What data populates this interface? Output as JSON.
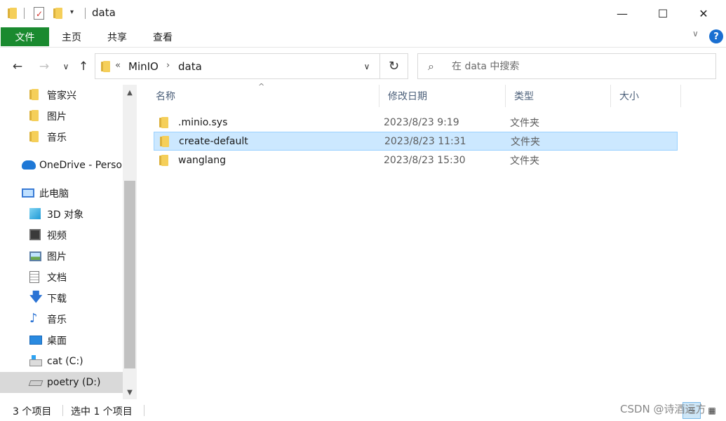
{
  "window": {
    "title": "data",
    "controls": {
      "minimize": "—",
      "maximize": "☐",
      "close": "✕"
    },
    "quick_access_dropdown": "▾"
  },
  "ribbon": {
    "file_tab": "文件",
    "tabs": [
      "主页",
      "共享",
      "查看"
    ],
    "expand_chevron": "∨",
    "help": "?"
  },
  "nav_buttons": {
    "back": "←",
    "forward": "→",
    "recent": "∨",
    "up": "↑"
  },
  "address": {
    "overflow": "«",
    "breadcrumbs": [
      "MinIO",
      "data"
    ],
    "separator": "›",
    "dropdown": "∨",
    "refresh": "↻"
  },
  "search": {
    "placeholder": "在 data 中搜索",
    "value": "",
    "icon": "search-icon"
  },
  "nav_pane": {
    "items": [
      {
        "label": "管家兴",
        "icon": "folder-icon"
      },
      {
        "label": "图片",
        "icon": "folder-icon"
      },
      {
        "label": "音乐",
        "icon": "folder-icon"
      },
      {
        "label": "OneDrive - Perso",
        "icon": "onedrive-icon"
      },
      {
        "label": "此电脑",
        "icon": "this-pc-icon"
      },
      {
        "label": "3D 对象",
        "icon": "3d-objects-icon"
      },
      {
        "label": "视频",
        "icon": "videos-icon"
      },
      {
        "label": "图片",
        "icon": "pictures-icon"
      },
      {
        "label": "文档",
        "icon": "documents-icon"
      },
      {
        "label": "下载",
        "icon": "downloads-icon"
      },
      {
        "label": "音乐",
        "icon": "music-icon"
      },
      {
        "label": "桌面",
        "icon": "desktop-icon"
      },
      {
        "label": "cat (C:)",
        "icon": "drive-c-icon"
      },
      {
        "label": "poetry (D:)",
        "icon": "drive-d-icon",
        "selected": true
      }
    ],
    "scroll_up": "▲",
    "scroll_down": "▼"
  },
  "file_list": {
    "columns": [
      "名称",
      "修改日期",
      "类型",
      "大小"
    ],
    "sort_caret": "^",
    "rows": [
      {
        "name": ".minio.sys",
        "modified": "2023/8/23 9:19",
        "type": "文件夹",
        "size": ""
      },
      {
        "name": "create-default",
        "modified": "2023/8/23 11:31",
        "type": "文件夹",
        "size": "",
        "selected": true
      },
      {
        "name": "wanglang",
        "modified": "2023/8/23 15:30",
        "type": "文件夹",
        "size": ""
      }
    ]
  },
  "status_bar": {
    "item_count": "3 个项目",
    "selection": "选中 1 个项目",
    "watermark": "CSDN @诗酒远方"
  },
  "colors": {
    "file_tab": "#1a8a2f",
    "selection_bg": "#cce8ff",
    "selection_border": "#99d1ff",
    "help": "#1a6fd1",
    "folder": "#f5cf5a"
  }
}
